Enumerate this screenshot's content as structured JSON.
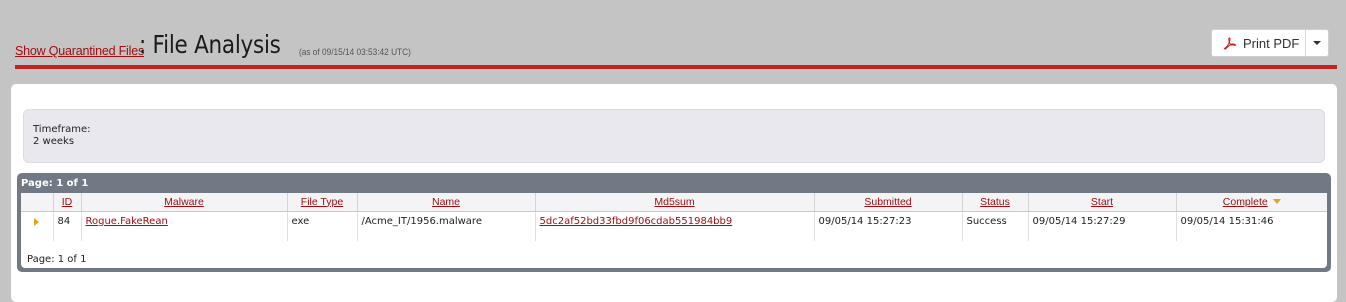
{
  "header": {
    "link_label": "Show Quarantined Files",
    "title": ": File Analysis",
    "timestamp": "(as of 09/15/14 03:53:42 UTC)"
  },
  "toolbar": {
    "print_label": "Print PDF",
    "pdf_icon": "pdf-icon",
    "caret_icon": "chevron-down-icon"
  },
  "filters": {
    "label": "Timeframe:",
    "value": "2 weeks"
  },
  "grid": {
    "pager_top": "Page: 1 of 1",
    "pager_bottom": "Page: 1 of 1",
    "columns": [
      "ID",
      "Malware",
      "File Type",
      "Name",
      "Md5sum",
      "Submitted",
      "Status",
      "Start",
      "Complete"
    ],
    "sorted_column": "Complete",
    "rows": [
      {
        "id": "84",
        "malware": "Rogue.FakeRean",
        "file_type": "exe",
        "name": "/Acme_IT/1956.malware",
        "md5sum": "5dc2af52bd33fbd9f06cdab551984bb9",
        "submitted": "09/05/14 15:27:23",
        "status": "Success",
        "start": "09/05/14 15:27:29",
        "complete": "09/05/14 15:31:46"
      }
    ]
  },
  "colors": {
    "accent": "#c2211f",
    "link": "#a10d10",
    "grid_header": "#717984"
  }
}
